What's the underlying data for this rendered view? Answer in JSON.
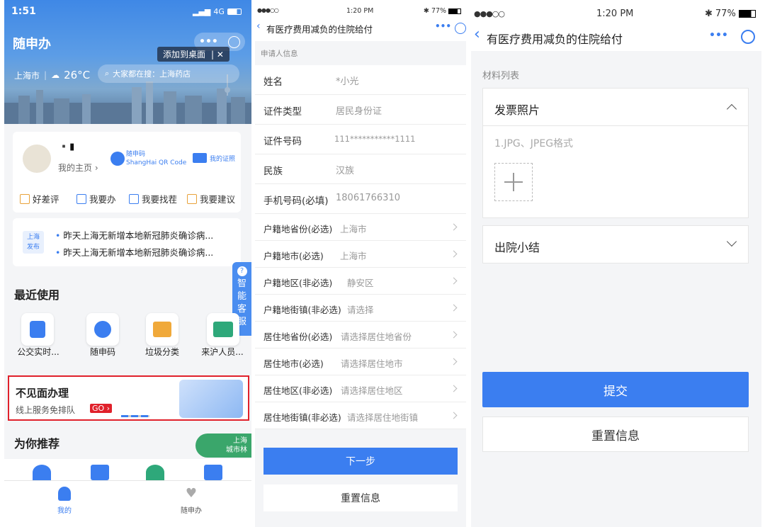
{
  "left": {
    "status": {
      "time": "1:51",
      "network": "4G"
    },
    "app_title": "随申办",
    "add_desktop": "添加到桌面",
    "city": "上海市",
    "temperature": "26°C",
    "search_placeholder": "大家都在搜：上海药店",
    "user": {
      "name": "▪️▮",
      "homepage": "我的主页",
      "qr_title": "随申码",
      "qr_sub": "ShangHai QR Code",
      "cert": "我的证照"
    },
    "tools": [
      "好差评",
      "我要办",
      "我要找茬",
      "我要建议"
    ],
    "news_badge": [
      "上海",
      "发布"
    ],
    "news": [
      "昨天上海无新增本地新冠肺炎确诊病...",
      "昨天上海无新增本地新冠肺炎确诊病..."
    ],
    "service_tab": [
      "智",
      "能",
      "客",
      "服"
    ],
    "recent_title": "最近使用",
    "recent": [
      "公交实时...",
      "随申码",
      "垃圾分类",
      "来沪人员..."
    ],
    "banner": {
      "title": "不见面办理",
      "sub": "线上服务免排队",
      "go": "GO"
    },
    "recommend_title": "为你推荐",
    "forest_badge": [
      "上海",
      "城市林"
    ],
    "nav": [
      "我的",
      "随申办"
    ]
  },
  "middle": {
    "status": {
      "carrier": "●●●○○",
      "time": "1:20 PM",
      "battery": "77%"
    },
    "title": "有医疗费用减负的住院给付",
    "section": "申请人信息",
    "fields": [
      {
        "label": "姓名",
        "value": "*小光"
      },
      {
        "label": "证件类型",
        "value": "居民身份证"
      },
      {
        "label": "证件号码",
        "value": "111***********1111"
      },
      {
        "label": "民族",
        "value": "汉族"
      },
      {
        "label": "手机号码(必填)",
        "value": "18061766310"
      }
    ],
    "selects": [
      {
        "label": "户籍地省份(必选)",
        "value": "上海市"
      },
      {
        "label": "户籍地市(必选)",
        "value": "上海市"
      },
      {
        "label": "户籍地区(非必选)",
        "value": "静安区"
      },
      {
        "label": "户籍地街镇(非必选)",
        "value": "请选择"
      },
      {
        "label": "居住地省份(必选)",
        "value": "请选择居住地省份"
      },
      {
        "label": "居住地市(必选)",
        "value": "请选择居住地市"
      },
      {
        "label": "居住地区(非必选)",
        "value": "请选择居住地区"
      },
      {
        "label": "居住地街镇(非必选)",
        "value": "请选择居住地街镇"
      }
    ],
    "next": "下一步",
    "reset": "重置信息"
  },
  "right": {
    "status": {
      "carrier": "●●●○○",
      "time": "1:20 PM",
      "battery": "77%"
    },
    "title": "有医疗费用减负的住院给付",
    "list_title": "材料列表",
    "invoice": "发票照片",
    "format_hint": "1.JPG、JPEG格式",
    "discharge": "出院小结",
    "submit": "提交",
    "reset": "重置信息"
  },
  "colors": {
    "primary": "#3b7ef0",
    "highlight_border": "#e0212b"
  }
}
